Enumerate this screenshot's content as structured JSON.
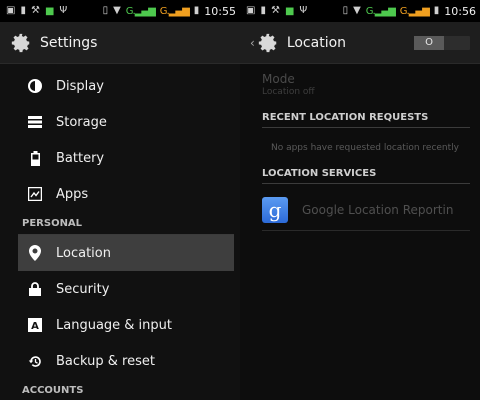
{
  "status_left": {
    "time": "10:55"
  },
  "status_right": {
    "time": "10:56"
  },
  "left": {
    "title": "Settings",
    "items_top": [
      {
        "label": "Display",
        "icon": "display-icon"
      },
      {
        "label": "Storage",
        "icon": "storage-icon"
      },
      {
        "label": "Battery",
        "icon": "battery-icon"
      },
      {
        "label": "Apps",
        "icon": "apps-icon"
      }
    ],
    "personal_header": "PERSONAL",
    "items_personal": [
      {
        "label": "Location",
        "icon": "location-pin-icon",
        "selected": true
      },
      {
        "label": "Security",
        "icon": "lock-icon"
      },
      {
        "label": "Language & input",
        "icon": "keyboard-icon"
      },
      {
        "label": "Backup & reset",
        "icon": "backup-icon"
      }
    ],
    "accounts_header": "ACCOUNTS"
  },
  "right": {
    "title": "Location",
    "toggle_state": "O",
    "mode_title": "Mode",
    "mode_sub": "Location off",
    "recent_header": "RECENT LOCATION REQUESTS",
    "no_apps_text": "No apps have requested location recently",
    "services_header": "LOCATION SERVICES",
    "service_label": "Google Location Reportin"
  },
  "colors": {
    "selected_bg": "#3e3e3e",
    "google_blue": "#3b7de6"
  }
}
